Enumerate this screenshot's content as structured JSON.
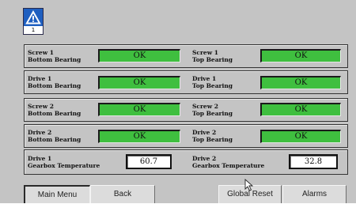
{
  "alarm_indicator": {
    "count": "1",
    "icon": "warning-triangle-icon"
  },
  "rows": [
    {
      "left": {
        "line1": "Screw 1",
        "line2": "Bottom Bearing",
        "status": "OK"
      },
      "right": {
        "line1": "Screw 1",
        "line2": "Top Bearing",
        "status": "OK"
      }
    },
    {
      "left": {
        "line1": "Drive 1",
        "line2": "Bottom Bearing",
        "status": "OK"
      },
      "right": {
        "line1": "Drive 1",
        "line2": "Top Bearing",
        "status": "OK"
      }
    },
    {
      "left": {
        "line1": "Screw 2",
        "line2": "Bottom Bearing",
        "status": "OK"
      },
      "right": {
        "line1": "Screw 2",
        "line2": "Top Bearing",
        "status": "OK"
      }
    },
    {
      "left": {
        "line1": "Drive 2",
        "line2": "Bottom Bearing",
        "status": "OK"
      },
      "right": {
        "line1": "Drive 2",
        "line2": "Top Bearing",
        "status": "OK"
      }
    }
  ],
  "temperatures": {
    "left": {
      "line1": "Drive 1",
      "line2": "Gearbox Temperature",
      "value": "60.7"
    },
    "right": {
      "line1": "Drive 2",
      "line2": "Gearbox Temperature",
      "value": "32.8"
    }
  },
  "buttons": {
    "main_menu": "Main Menu",
    "back": "Back",
    "global_reset": "Global Reset",
    "alarms": "Alarms"
  },
  "colors": {
    "ok_green": "#3fbf3f",
    "panel_gray": "#c4c4c4",
    "alarm_blue": "#1f5fc0"
  }
}
